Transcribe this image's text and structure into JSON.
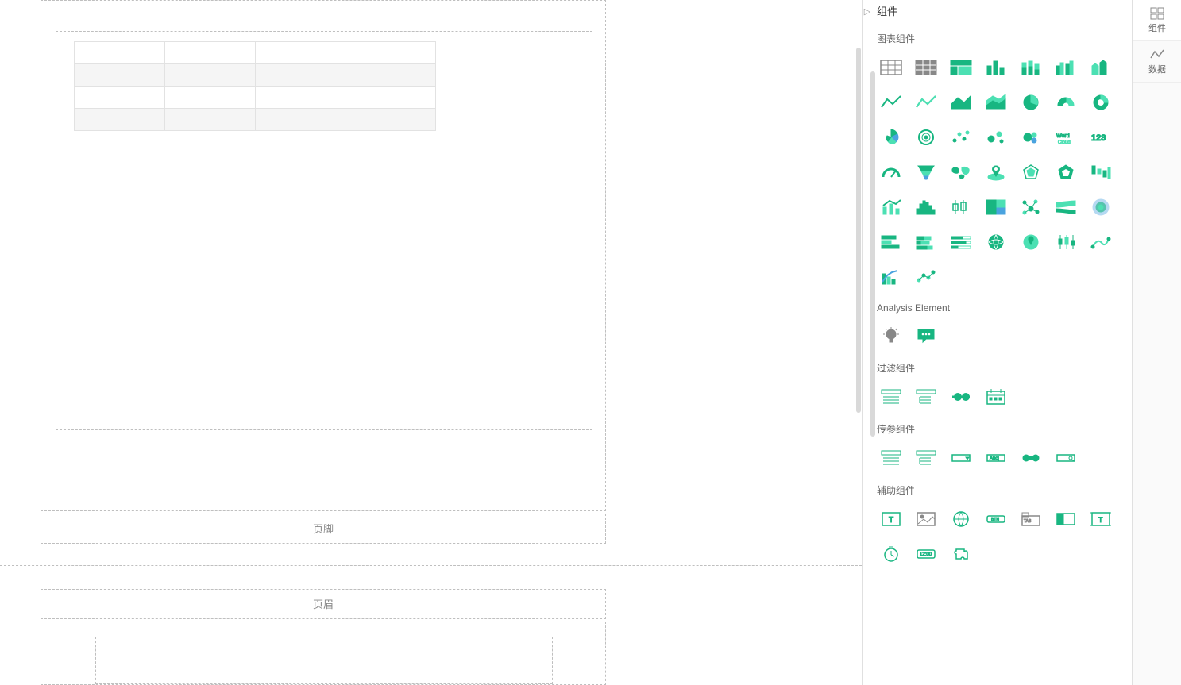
{
  "canvas": {
    "page_footer_label": "页脚",
    "page_header_label": "页眉",
    "table": {
      "rows": 4,
      "cols": 4
    }
  },
  "sidebar": {
    "collapse_glyph": "▷",
    "title": "组件",
    "sections": {
      "charts": {
        "label": "图表组件"
      },
      "analysis": {
        "label": "Analysis Element"
      },
      "filter": {
        "label": "过滤组件"
      },
      "param": {
        "label": "传参组件"
      },
      "aux": {
        "label": "辅助组件"
      }
    }
  },
  "tabs": {
    "components": "组件",
    "data": "数据"
  }
}
